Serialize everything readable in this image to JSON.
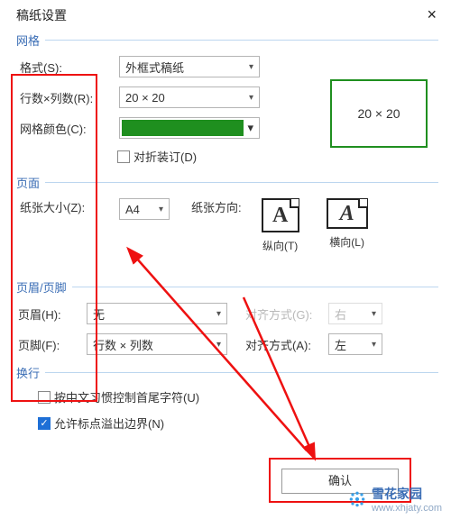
{
  "title": "稿纸设置",
  "sections": {
    "grid": "网格",
    "page": "页面",
    "hf": "页眉/页脚",
    "wrap": "换行"
  },
  "grid": {
    "format_label": "格式(S):",
    "format_value": "外框式稿纸",
    "rowscols_label": "行数×列数(R):",
    "rowscols_value": "20 × 20",
    "color_label": "网格颜色(C):",
    "color_value": "#1f8f1f",
    "fold_label": "对折装订(D)",
    "preview": "20 × 20"
  },
  "page": {
    "size_label": "纸张大小(Z):",
    "size_value": "A4",
    "orient_label": "纸张方向:",
    "portrait_label": "纵向(T)",
    "landscape_label": "横向(L)",
    "glyph": "A"
  },
  "hf": {
    "header_label": "页眉(H):",
    "header_value": "无",
    "footer_label": "页脚(F):",
    "footer_value": "行数 × 列数",
    "align_g_label": "对齐方式(G):",
    "align_g_value": "右",
    "align_a_label": "对齐方式(A):",
    "align_a_value": "左"
  },
  "wrap": {
    "cjk_label": "按中文习惯控制首尾字符(U)",
    "overflow_label": "允许标点溢出边界(N)"
  },
  "buttons": {
    "ok": "确认"
  },
  "watermark": {
    "brand": "雪花家园",
    "url": "www.xhjaty.com"
  }
}
